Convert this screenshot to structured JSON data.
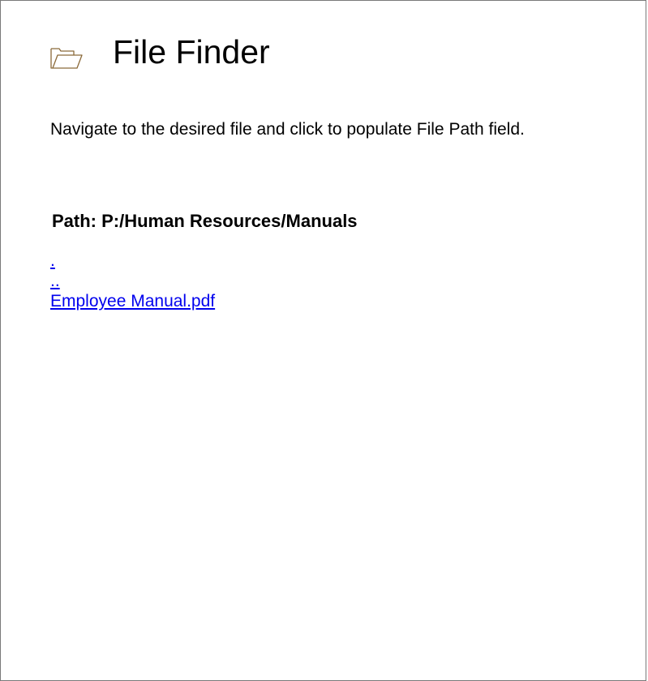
{
  "app": {
    "title": "File Finder",
    "icon": "open-folder-icon"
  },
  "instructions": "Navigate to the desired file and click to populate File Path field.",
  "path": {
    "label": "Path: P:/Human Resources/Manuals"
  },
  "entries": [
    {
      "name": "."
    },
    {
      "name": ".."
    },
    {
      "name": "Employee Manual.pdf"
    }
  ],
  "colors": {
    "link": "#0000ee",
    "icon_stroke": "#8b6a3a",
    "border": "#7a7a7a"
  }
}
